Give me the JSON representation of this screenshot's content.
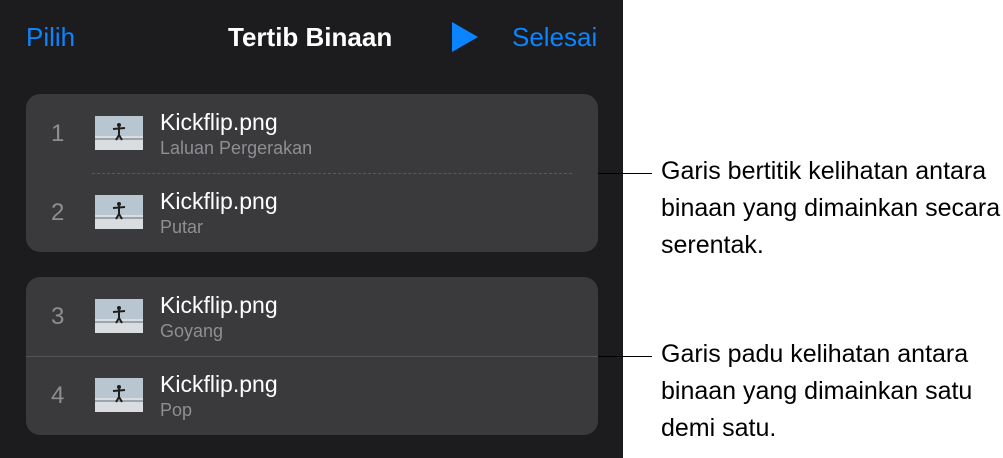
{
  "toolbar": {
    "select_label": "Pilih",
    "title": "Tertib Binaan",
    "play_icon": "play-icon",
    "done_label": "Selesai",
    "accent_color": "#0a84ff"
  },
  "groups": [
    {
      "separator": "dotted",
      "items": [
        {
          "number": "1",
          "name": "Kickflip.png",
          "effect": "Laluan Pergerakan"
        },
        {
          "number": "2",
          "name": "Kickflip.png",
          "effect": "Putar"
        }
      ]
    },
    {
      "separator": "solid",
      "items": [
        {
          "number": "3",
          "name": "Kickflip.png",
          "effect": "Goyang"
        },
        {
          "number": "4",
          "name": "Kickflip.png",
          "effect": "Pop"
        }
      ]
    }
  ],
  "callouts": {
    "dotted": "Garis bertitik kelihatan antara binaan yang dimainkan secara serentak.",
    "solid": "Garis padu kelihatan antara binaan yang dimainkan satu demi satu."
  }
}
